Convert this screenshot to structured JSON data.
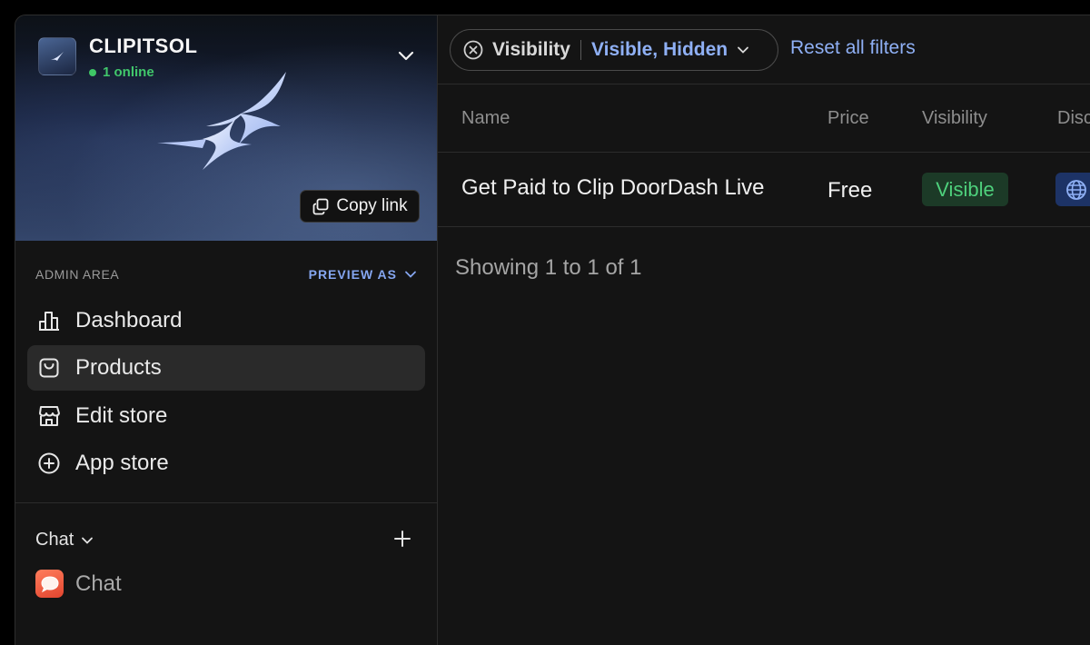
{
  "store": {
    "name": "CLIPITSOL",
    "online_status": "1 online",
    "copy_link_label": "Copy link"
  },
  "admin": {
    "section_label": "ADMIN AREA",
    "preview_as_label": "PREVIEW AS"
  },
  "nav": {
    "items": [
      {
        "label": "Dashboard",
        "icon": "bar-chart-icon",
        "active": false
      },
      {
        "label": "Products",
        "icon": "shopping-bag-icon",
        "active": true
      },
      {
        "label": "Edit store",
        "icon": "storefront-icon",
        "active": false
      },
      {
        "label": "App store",
        "icon": "plus-circle-icon",
        "active": false
      }
    ]
  },
  "chat": {
    "section_label": "Chat",
    "item_label": "Chat",
    "item_icon": "chat-bubble-icon"
  },
  "filters": {
    "chip_name": "Visibility",
    "chip_values": "Visible, Hidden",
    "reset_label": "Reset all filters"
  },
  "table": {
    "columns": [
      "Name",
      "Price",
      "Visibility",
      "Disc"
    ],
    "rows": [
      {
        "name": "Get Paid to Clip DoorDash Live",
        "price": "Free",
        "visibility": "Visible",
        "icon": "globe-icon"
      }
    ],
    "summary": "Showing 1 to 1 of 1"
  },
  "colors": {
    "accent_blue": "#8fb0f5",
    "online_green": "#41c76b",
    "visible_badge_bg": "#1c3a27",
    "visible_badge_text": "#4ed07c",
    "chat_icon": "#ef5a3f"
  }
}
